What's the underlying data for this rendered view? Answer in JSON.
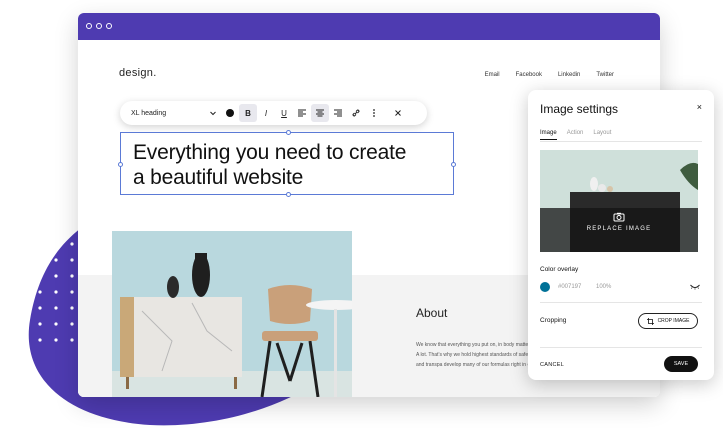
{
  "site": {
    "logo": "design.",
    "nav": [
      "Email",
      "Facebook",
      "Linkedin",
      "Twitter"
    ],
    "heading_line1": "Everything you need to create",
    "heading_line2": "a beautiful website",
    "about_title": "About",
    "about_text": "We know that everything you put on, in body matters. A lot. That’s why we hold highest standards of safety and transpa develop many of our formulas right in ou"
  },
  "toolbar": {
    "style_value": "XL heading",
    "icons": [
      "chevron-down-icon",
      "color-dot-icon",
      "bold-icon",
      "italic-icon",
      "underline-icon",
      "align-left-icon",
      "align-center-icon",
      "align-right-icon",
      "link-icon",
      "more-icon",
      "close-icon"
    ],
    "bold": "B",
    "italic": "I",
    "underline": "U"
  },
  "panel": {
    "title": "Image settings",
    "close": "×",
    "tabs": [
      "Image",
      "Action",
      "Layout"
    ],
    "active_tab": "Image",
    "replace_label": "REPLACE IMAGE",
    "color_overlay_label": "Color overlay",
    "overlay_hex": "#007197",
    "overlay_opacity": "100%",
    "cropping_label": "Cropping",
    "crop_button": "CROP IMAGE",
    "cancel": "CANCEL",
    "save": "SAVE"
  },
  "colors": {
    "accent_purple": "#4e3bb1",
    "overlay": "#007197",
    "selection_blue": "#5b7ad6"
  }
}
